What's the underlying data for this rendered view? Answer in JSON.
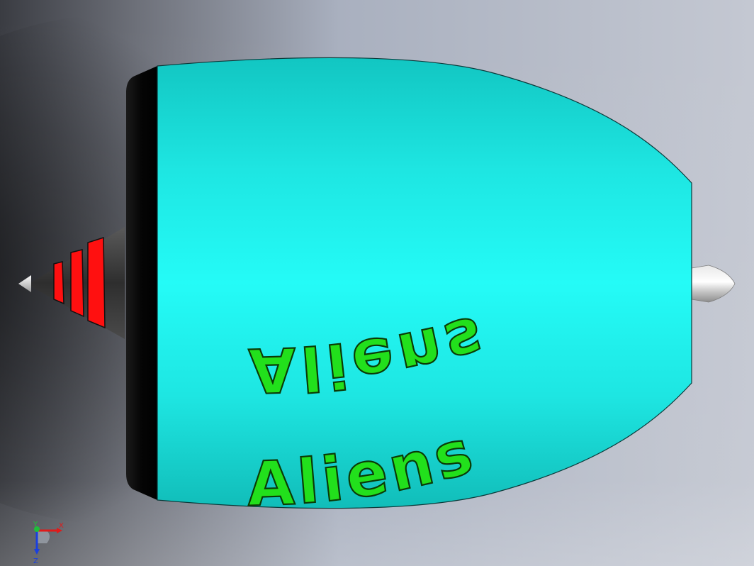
{
  "model": {
    "body_color": "#1ff4ef",
    "cap_color": "#000000",
    "engraving_color": "#22e01c",
    "cone_stripe_color": "#ff0000",
    "engraving_top": "Aliens",
    "engraving_bottom": "Aliens"
  },
  "triad": {
    "x_label": "X",
    "y_label": "Y",
    "z_label": "Z",
    "x_color": "#e01a1a",
    "y_color": "#1fbf3a",
    "z_color": "#1a3fe0"
  }
}
